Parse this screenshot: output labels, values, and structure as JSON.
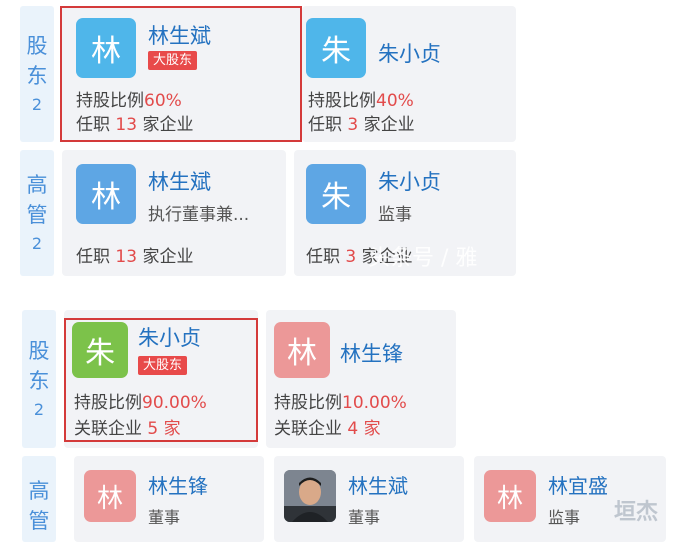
{
  "top": {
    "shareholders": {
      "side": {
        "title_1": "股",
        "title_2": "东",
        "count": "2"
      },
      "cards": [
        {
          "avatar": "林",
          "name": "林生斌",
          "tag": "大股东",
          "ratio_label": "持股比例",
          "ratio_value": "60%",
          "job_prefix": "任职",
          "job_count": "13",
          "job_suffix": "家企业"
        },
        {
          "avatar": "朱",
          "name": "朱小贞",
          "ratio_label": "持股比例",
          "ratio_value": "40%",
          "job_prefix": "任职",
          "job_count": "3",
          "job_suffix": "家企业"
        }
      ]
    },
    "executives": {
      "side": {
        "title_1": "高",
        "title_2": "管",
        "count": "2"
      },
      "cards": [
        {
          "avatar": "林",
          "name": "林生斌",
          "role": "执行董事兼...",
          "job_prefix": "任职",
          "job_count": "13",
          "job_suffix": "家企业"
        },
        {
          "avatar": "朱",
          "name": "朱小贞",
          "role": "监事",
          "job_prefix": "任职",
          "job_count": "3",
          "job_suffix": "家企业"
        }
      ]
    },
    "watermark": "头条号 / 雅"
  },
  "bottom": {
    "shareholders": {
      "side": {
        "title_1": "股",
        "title_2": "东",
        "count": "2"
      },
      "cards": [
        {
          "avatar": "朱",
          "name": "朱小贞",
          "tag": "大股东",
          "ratio_label": "持股比例",
          "ratio_value": "90.00%",
          "rel_label": "关联企业",
          "rel_count": "5",
          "rel_suffix": "家"
        },
        {
          "avatar": "林",
          "name": "林生锋",
          "ratio_label": "持股比例",
          "ratio_value": "10.00%",
          "rel_label": "关联企业",
          "rel_count": "4",
          "rel_suffix": "家"
        }
      ]
    },
    "executives": {
      "side": {
        "title_1": "高",
        "title_2": "管"
      },
      "cards": [
        {
          "avatar": "林",
          "name": "林生锋",
          "role": "董事"
        },
        {
          "name": "林生斌",
          "role": "董事"
        },
        {
          "avatar": "林",
          "name": "林宜盛",
          "role": "监事"
        }
      ]
    },
    "watermark": "垣杰"
  },
  "colors": {
    "accent": "#2472c0",
    "highlight": "#e24b4b",
    "box": "#d43a3a",
    "side_bg": "#eaf3fb"
  }
}
